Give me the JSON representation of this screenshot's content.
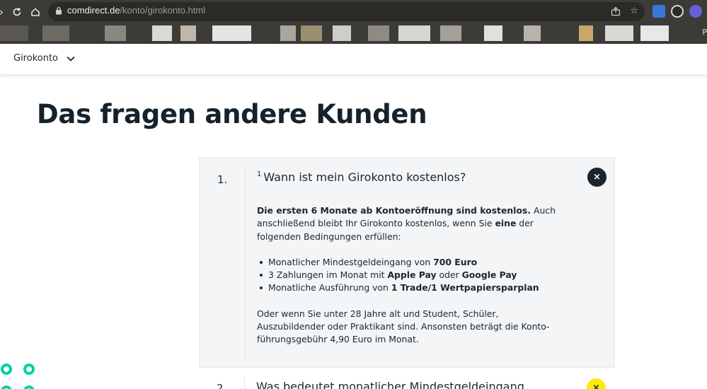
{
  "browser": {
    "url_host": "comdirect.de",
    "url_path": "/konto/girokonto.html",
    "bookmark_tail": "P"
  },
  "site_nav": {
    "label": "Girokonto"
  },
  "page": {
    "title": "Das fragen andere Kunden"
  },
  "faq": {
    "open_item": {
      "number": "1.",
      "footnote": "1",
      "question": "Wann ist mein Girokonto kostenlos?",
      "close_symbol": "×",
      "intro_bold": "Die ersten 6 Monate ab Kontoeröffnung sind kostenlos.",
      "intro_rest_1": " Auch anschließend bleibt Ihr Girokonto kostenlos, wenn Sie ",
      "intro_bold_2": "eine",
      "intro_rest_2": " der folgenden Bedingungen erfüllen:",
      "conditions": [
        {
          "text": "Monatlicher Mindestgeldeingang von ",
          "bold": "700 Euro",
          "text2": "",
          "bold2": ""
        },
        {
          "text": "3 Zahlungen im Monat mit ",
          "bold": "Apple Pay",
          "text2": " oder ",
          "bold2": "Google Pay"
        },
        {
          "text": "Monatliche Ausführung von ",
          "bold": "1 Trade/1 Wertpapiersparplan",
          "text2": "",
          "bold2": ""
        }
      ],
      "outro": "Oder wenn Sie unter 28 Jahre alt und Student, Schüler, Auszubildender oder Praktikant sind. Ansonsten beträgt die Konto­führungsgebühr 4,90 Euro im Monat."
    },
    "next_item": {
      "number": "2.",
      "question": "Was bedeutet monatlicher Mindestgeldeingang",
      "open_symbol": "×"
    }
  },
  "colors": {
    "accent_yellow": "#ffeb00",
    "accent_teal": "#00d1a3",
    "dark": "#1a252d",
    "panel": "#f3f5f6"
  },
  "icons": [
    "back-icon",
    "reload-icon",
    "home-icon",
    "lock-icon",
    "share-icon",
    "star-icon",
    "translate-icon",
    "extension-icon",
    "profile-icon",
    "chevron-down-icon",
    "close-icon"
  ]
}
